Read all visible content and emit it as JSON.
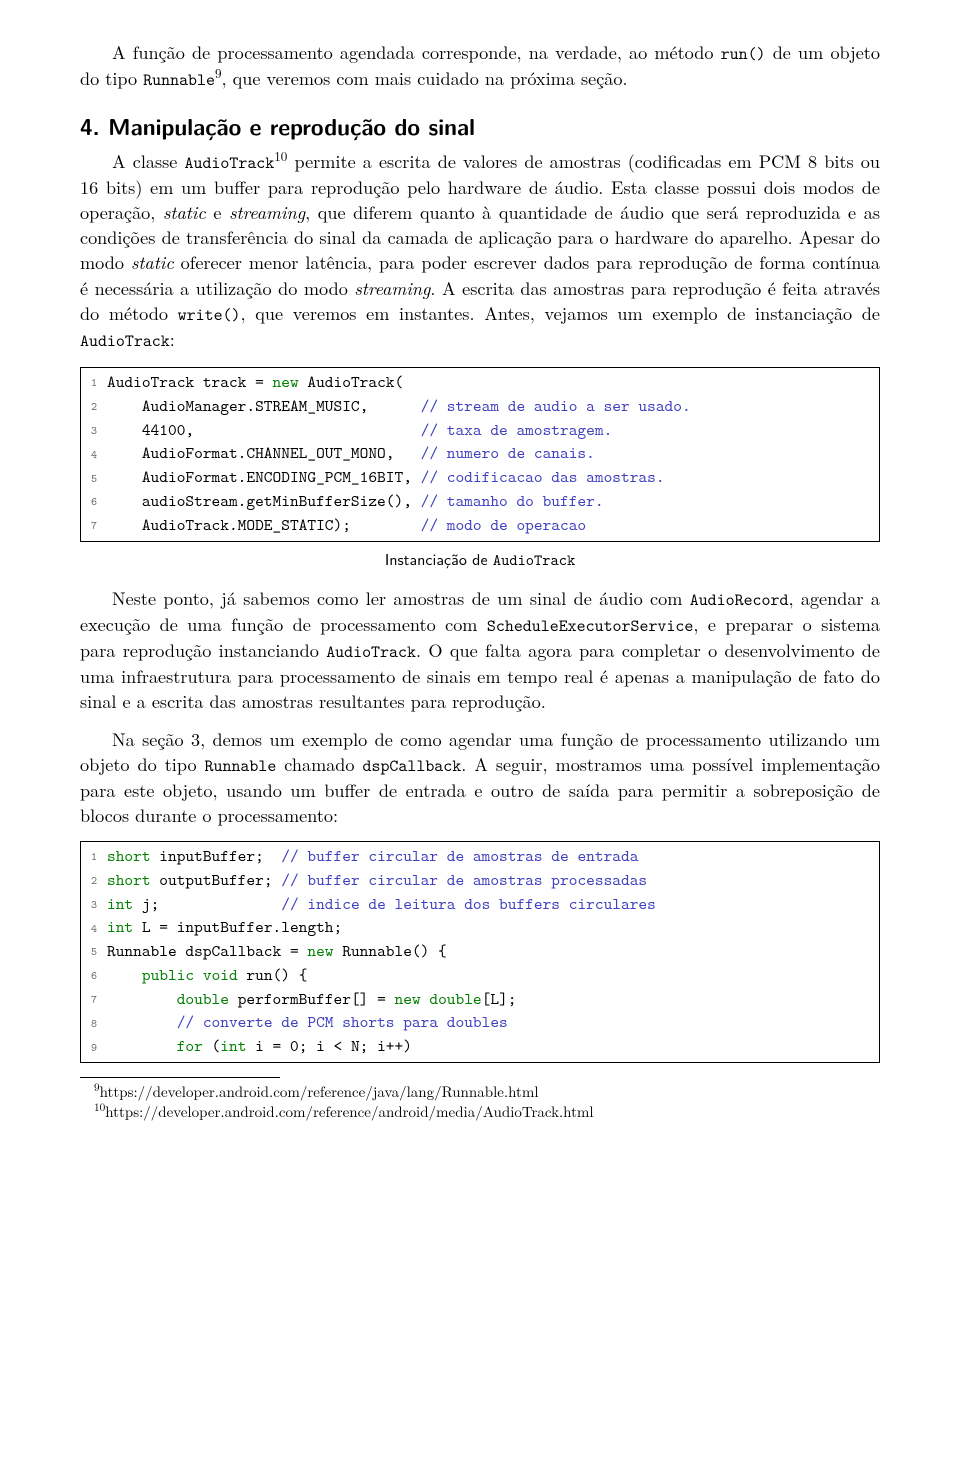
{
  "para1_a": "A função de processamento agendada corresponde, na verdade, ao método ",
  "para1_run": "run()",
  "para1_b": " de um objeto do tipo ",
  "para1_runnable": "Runnable",
  "para1_fn9": "9",
  "para1_c": ", que veremos com mais cuidado na próxima seção.",
  "heading": "4. Manipulação e reprodução do sinal",
  "para2_a": "A classe ",
  "para2_at": "AudioTrack",
  "para2_fn10": "10",
  "para2_b": " permite a escrita de valores de amostras (codificadas em PCM 8 bits ou 16 bits) em um buffer para reprodução pelo hardware de áudio. Esta classe possui dois modos de operação, ",
  "para2_static": "static",
  "para2_c": " e ",
  "para2_stream": "streaming",
  "para2_d": ", que diferem quanto à quantidade de áudio que será reproduzida e as condições de transferência do sinal da camada de aplicação para o hardware do aparelho. Apesar do modo ",
  "para2_static2": "static",
  "para2_e": " oferecer menor latência, para poder escrever dados para reprodução de forma contínua é necessária a utilização do modo ",
  "para2_stream2": "streaming",
  "para2_f": ". A escrita das amostras para reprodução é feita através do método ",
  "para2_write": "write()",
  "para2_g": ", que veremos em instantes. Antes, vejamos um exemplo de instanciação de ",
  "para2_at2": "AudioTrack",
  "para2_h": ":",
  "code1": {
    "ln": [
      "1",
      "2",
      "3",
      "4",
      "5",
      "6",
      "7"
    ],
    "l1_a": "AudioTrack track = ",
    "l1_new": "new",
    "l1_b": " AudioTrack(",
    "l2_a": "    AudioManager.STREAM_MUSIC,      ",
    "l2_c": "// stream de audio a ser usado.",
    "l3_a": "    44100,                          ",
    "l3_c": "// taxa de amostragem.",
    "l4_a": "    AudioFormat.CHANNEL_OUT_MONO,   ",
    "l4_c": "// numero de canais.",
    "l5_a": "    AudioFormat.ENCODING_PCM_16BIT, ",
    "l5_c": "// codificacao das amostras.",
    "l6_a": "    audioStream.getMinBufferSize(), ",
    "l6_c": "// tamanho do buffer.",
    "l7_a": "    AudioTrack.MODE_STATIC);        ",
    "l7_c": "// modo de operacao"
  },
  "caption1_a": "Instanciação de ",
  "caption1_tt": "AudioTrack",
  "para3_a": "Neste ponto, já sabemos como ler amostras de um sinal de áudio com ",
  "para3_ar": "AudioRecord",
  "para3_b": ", agendar a execução de uma função de processamento com ",
  "para3_se": "ScheduleExecutorService",
  "para3_c": ", e preparar o sistema para reprodução instanciando ",
  "para3_at": "AudioTrack",
  "para3_d": ". O que falta agora para completar o desenvolvimento de uma infraestrutura para processamento de sinais em tempo real é apenas a manipulação de fato do sinal e a escrita das amostras resultantes para reprodução.",
  "para4_a": "Na seção 3, demos um exemplo de como agendar uma função de processamento utilizando um objeto do tipo ",
  "para4_run": "Runnable",
  "para4_b": " chamado ",
  "para4_cb": "dspCallback",
  "para4_c": ". A seguir, mostramos uma possível implementação para este objeto, usando um buffer de entrada e outro de saída para permitir a sobreposição de blocos durante o processamento:",
  "code2": {
    "ln": [
      "1",
      "2",
      "3",
      "4",
      "5",
      "6",
      "7",
      "8",
      "9"
    ],
    "l1_kw": "short",
    "l1_a": " inputBuffer;  ",
    "l1_c": "// buffer circular de amostras de entrada",
    "l2_kw": "short",
    "l2_a": " outputBuffer; ",
    "l2_c": "// buffer circular de amostras processadas",
    "l3_kw": "int",
    "l3_a": " j;              ",
    "l3_c": "// indice de leitura dos buffers circulares",
    "l4_kw": "int",
    "l4_a": " L = inputBuffer.length;",
    "l5_a": "Runnable dspCallback = ",
    "l5_new": "new",
    "l5_b": " Runnable() {",
    "l6_a": "    ",
    "l6_kw1": "public",
    "l6_sp": " ",
    "l6_kw2": "void",
    "l6_b": " run() {",
    "l7_a": "        ",
    "l7_kw": "double",
    "l7_b": " performBuffer[] = ",
    "l7_new": "new",
    "l7_c": " ",
    "l7_kw2": "double",
    "l7_d": "[L];",
    "l8_a": "        ",
    "l8_c": "// converte de PCM shorts para doubles",
    "l9_a": "        ",
    "l9_kw": "for",
    "l9_b": " (",
    "l9_kw2": "int",
    "l9_c": " i = 0; i < N; i++)"
  },
  "fn9_sup": "9",
  "fn9_text": "https://developer.android.com/reference/java/lang/Runnable.html",
  "fn10_sup": "10",
  "fn10_text": "https://developer.android.com/reference/android/media/AudioTrack.html"
}
